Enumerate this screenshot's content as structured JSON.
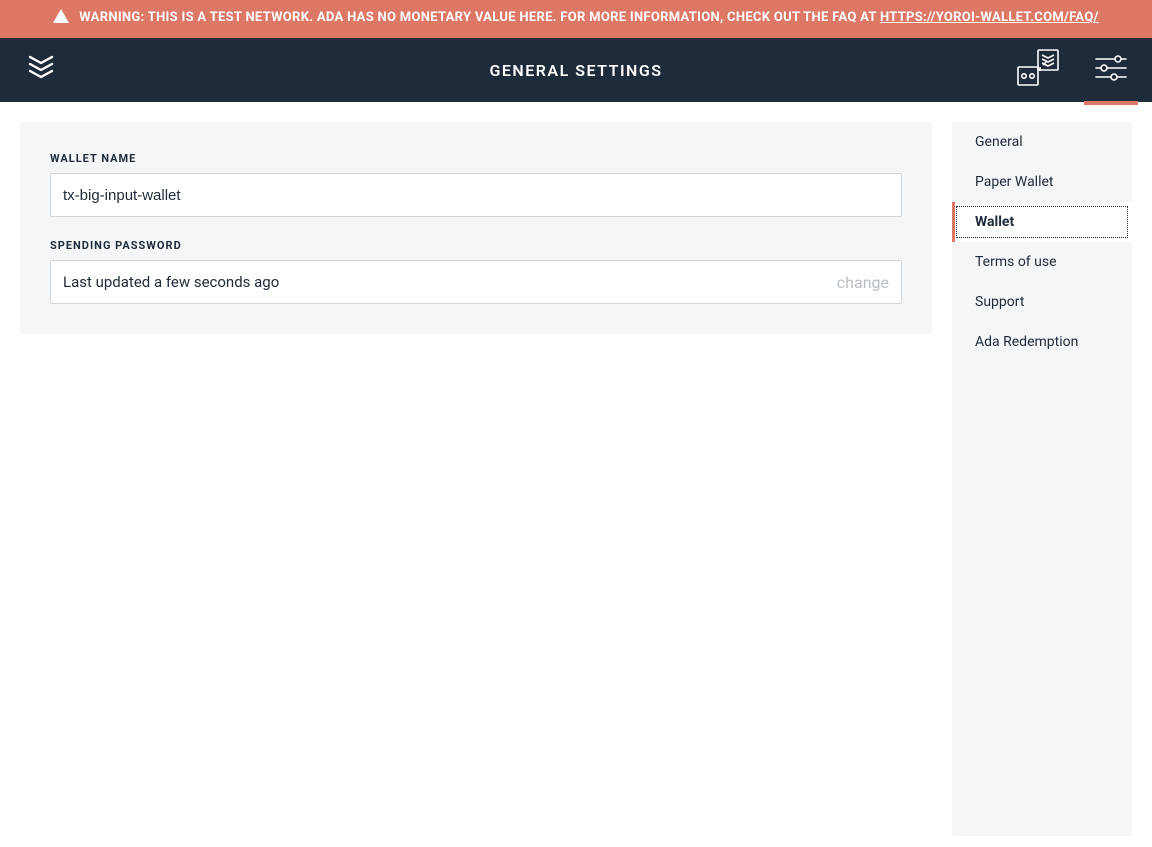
{
  "banner": {
    "text_before": "WARNING: THIS IS A TEST NETWORK. ADA HAS NO MONETARY VALUE HERE. FOR MORE INFORMATION, CHECK OUT THE FAQ AT ",
    "link_text": "HTTPS://YOROI-WALLET.COM/FAQ/"
  },
  "header": {
    "title": "GENERAL SETTINGS"
  },
  "form": {
    "wallet_name_label": "WALLET NAME",
    "wallet_name_value": "tx-big-input-wallet",
    "spending_password_label": "SPENDING PASSWORD",
    "spending_password_status": "Last updated a few seconds ago",
    "change_label": "change"
  },
  "sidebar": {
    "items": [
      {
        "label": "General",
        "active": false
      },
      {
        "label": "Paper Wallet",
        "active": false
      },
      {
        "label": "Wallet",
        "active": true
      },
      {
        "label": "Terms of use",
        "active": false
      },
      {
        "label": "Support",
        "active": false
      },
      {
        "label": "Ada Redemption",
        "active": false
      }
    ]
  }
}
